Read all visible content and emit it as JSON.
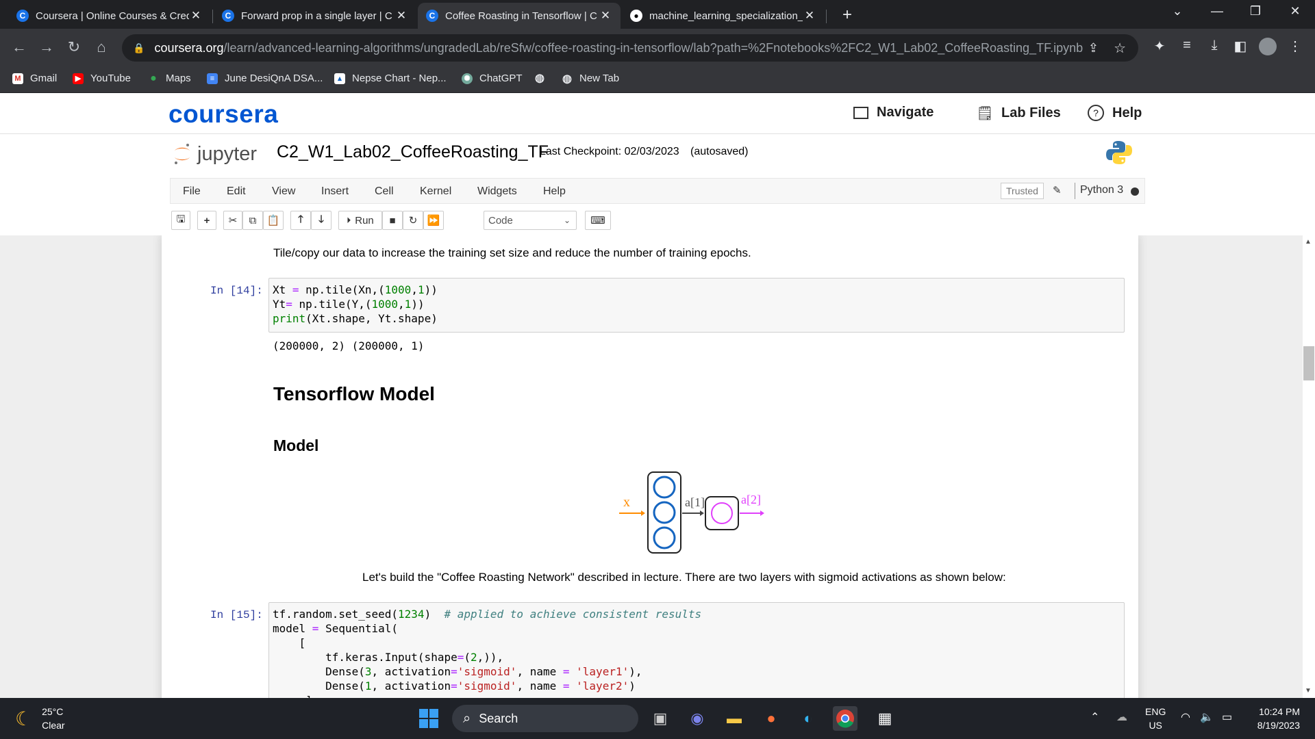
{
  "browser": {
    "tabs": [
      {
        "title": "Coursera | Online Courses & Cred",
        "favicon": "C",
        "active": false
      },
      {
        "title": "Forward prop in a single layer | C",
        "favicon": "C",
        "active": false
      },
      {
        "title": "Coffee Roasting in Tensorflow | C",
        "favicon": "C",
        "active": true
      },
      {
        "title": "machine_learning_specialization_",
        "favicon": "github",
        "active": false
      }
    ],
    "url_domain": "coursera.org",
    "url_path": "/learn/advanced-learning-algorithms/ungradedLab/reSfw/coffee-roasting-in-tensorflow/lab?path=%2Fnotebooks%2FC2_W1_Lab02_CoffeeRoasting_TF.ipynb",
    "bookmarks": [
      "Gmail",
      "YouTube",
      "Maps",
      "June DesiQnA DSA...",
      "Nepse Chart - Nep...",
      "ChatGPT",
      "",
      "New Tab"
    ]
  },
  "coursera": {
    "logo": "coursera",
    "nav": [
      "Navigate",
      "Lab Files",
      "Help"
    ]
  },
  "jupyter": {
    "logo_text": "jupyter",
    "notebook_name": "C2_W1_Lab02_CoffeeRoasting_TF",
    "checkpoint": "Last Checkpoint: 02/03/2023",
    "autosave": "(autosaved)",
    "menus": [
      "File",
      "Edit",
      "View",
      "Insert",
      "Cell",
      "Kernel",
      "Widgets",
      "Help"
    ],
    "trusted": "Trusted",
    "kernel": "Python 3",
    "run_label": "Run",
    "cell_type": "Code"
  },
  "notebook": {
    "md1": "Tile/copy our data to increase the training set size and reduce the number of training epochs.",
    "prompt1": "In [14]:",
    "output1": "(200000, 2) (200000, 1)",
    "h_tensorflow": "Tensorflow Model",
    "h_model": "Model",
    "diagram": {
      "x_label": "x",
      "a1_label": "a[1]",
      "a2_label": "a[2]"
    },
    "md2": "Let's build the \"Coffee Roasting Network\" described in lecture. There are two layers with sigmoid activations as shown below:",
    "prompt2": "In [15]:"
  },
  "taskbar": {
    "temperature": "25°C",
    "condition": "Clear",
    "search": "Search",
    "lang1": "ENG",
    "lang2": "US",
    "time": "10:24 PM",
    "date": "8/19/2023"
  }
}
